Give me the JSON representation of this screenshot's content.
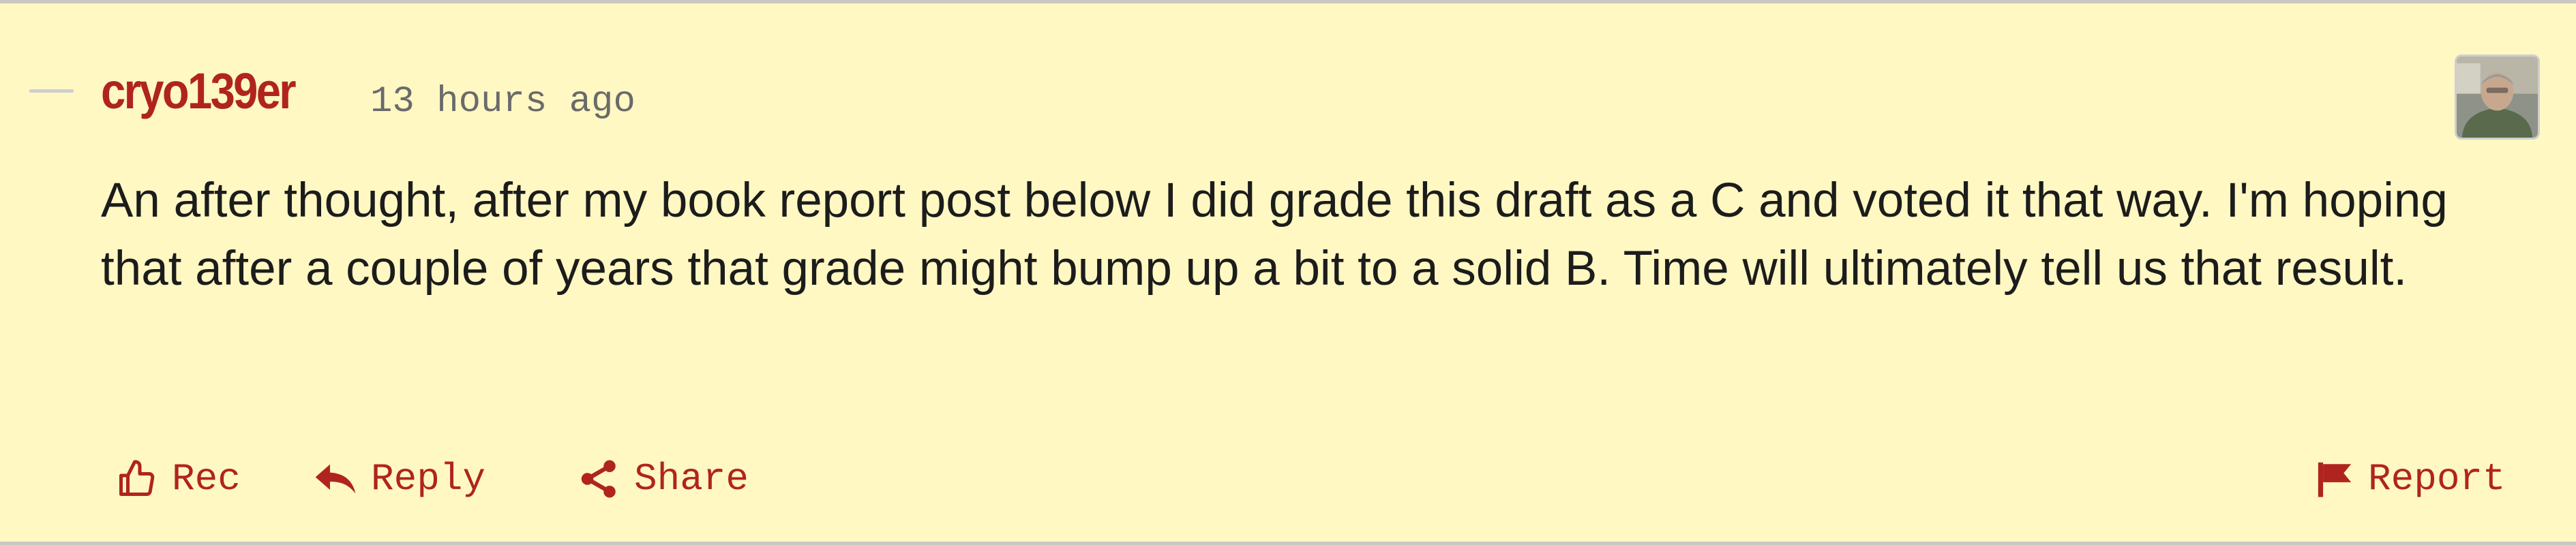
{
  "comment": {
    "username": "cryo139er",
    "timestamp": "13 hours ago",
    "body": "An after thought, after my book report post below I did grade this draft as a C and voted it that way. I'm hoping that after a couple of years that grade might bump up a bit to a solid B. Time will ultimately tell us that result."
  },
  "actions": {
    "rec_label": "Rec",
    "reply_label": "Reply",
    "share_label": "Share",
    "report_label": "Report"
  },
  "icons": {
    "collapse": "collapse-dash-icon",
    "avatar": "user-avatar",
    "rec": "thumbs-up-icon",
    "reply": "reply-arrow-icon",
    "share": "share-icon",
    "report": "flag-icon"
  },
  "colors": {
    "background": "#fff8c3",
    "accent": "#b0241f",
    "text": "#1c1c1c",
    "timestamp": "#6a6a6a",
    "border": "#c9c9c4"
  }
}
